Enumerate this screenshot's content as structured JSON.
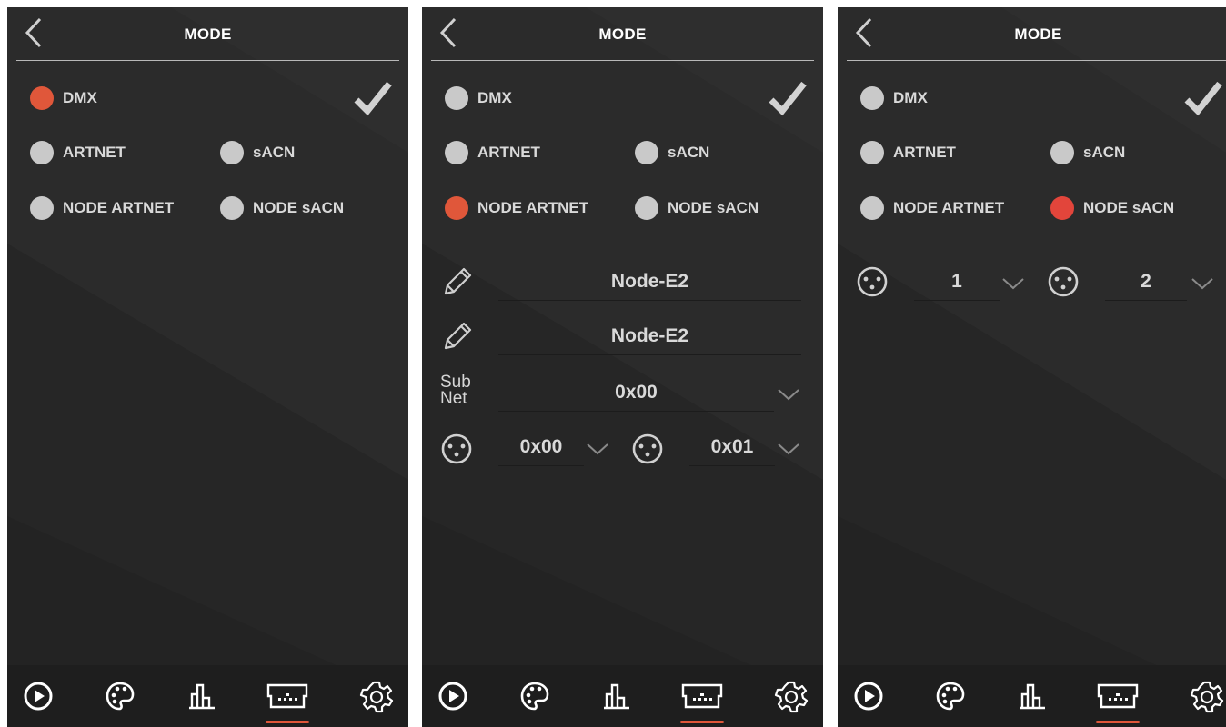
{
  "panels": [
    {
      "title": "MODE",
      "modes": {
        "dmx": {
          "label": "DMX",
          "active": true
        },
        "artnet": {
          "label": "ARTNET",
          "active": false
        },
        "sacn": {
          "label": "sACN",
          "active": false
        },
        "node_artnet": {
          "label": "NODE ARTNET",
          "active": false
        },
        "node_sacn": {
          "label": "NODE sACN",
          "active": false
        }
      },
      "tabs": [
        "play-tab",
        "palette-tab",
        "stats-tab",
        "display-tab",
        "settings-tab"
      ],
      "active_tab": "display-tab"
    },
    {
      "title": "MODE",
      "modes": {
        "dmx": {
          "label": "DMX",
          "active": false
        },
        "artnet": {
          "label": "ARTNET",
          "active": false
        },
        "sacn": {
          "label": "sACN",
          "active": false
        },
        "node_artnet": {
          "label": "NODE ARTNET",
          "active": true
        },
        "node_sacn": {
          "label": "NODE sACN",
          "active": false
        }
      },
      "node_name_1": "Node-E2",
      "node_name_2": "Node-E2",
      "subnet_label_line1": "Sub",
      "subnet_label_line2": "Net",
      "subnet_value": "0x00",
      "universe_1": "0x00",
      "universe_2": "0x01",
      "active_tab": "display-tab"
    },
    {
      "title": "MODE",
      "modes": {
        "dmx": {
          "label": "DMX",
          "active": false
        },
        "artnet": {
          "label": "ARTNET",
          "active": false
        },
        "sacn": {
          "label": "sACN",
          "active": false
        },
        "node_artnet": {
          "label": "NODE ARTNET",
          "active": false
        },
        "node_sacn": {
          "label": "NODE sACN",
          "active": true
        }
      },
      "universe_1": "1",
      "universe_2": "2",
      "active_tab": "display-tab"
    }
  ],
  "colors": {
    "accent": "#e0573a",
    "panel_bg": "#2b2b2b",
    "tabbar_bg": "#1e1e1e",
    "radio_inactive": "#c9c9c9"
  },
  "icons": [
    "back-chevron-icon",
    "checkmark-icon",
    "pencil-icon",
    "xlr-connector-icon",
    "chevron-down-icon",
    "play-icon",
    "palette-icon",
    "bar-chart-icon",
    "display-icon",
    "gear-icon"
  ]
}
